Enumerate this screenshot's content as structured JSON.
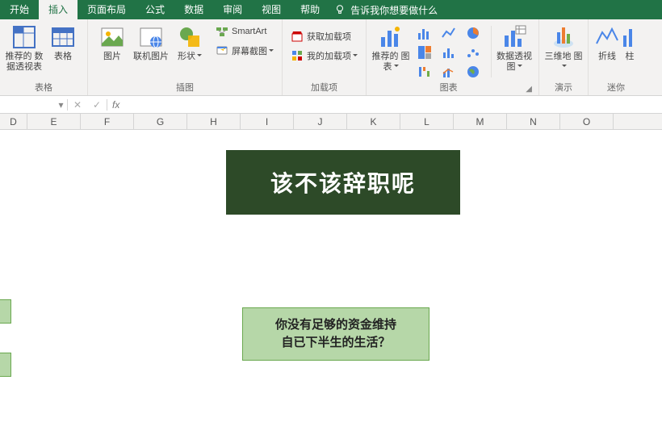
{
  "tabs": {
    "start": "开始",
    "insert": "插入",
    "layout": "页面布局",
    "formula": "公式",
    "data": "数据",
    "review": "审阅",
    "view": "视图",
    "help": "帮助",
    "tellme": "告诉我你想要做什么"
  },
  "ribbon": {
    "tables": {
      "pivottable": "推荐的\n数据透视表",
      "table": "表格",
      "label": "表格"
    },
    "illus": {
      "picture": "图片",
      "online": "联机图片",
      "shapes": "形状",
      "smartart": "SmartArt",
      "screenshot": "屏幕截图",
      "label": "插图"
    },
    "addins": {
      "get": "获取加载项",
      "my": "我的加载项",
      "label": "加载项"
    },
    "charts": {
      "recommended": "推荐的\n图表",
      "pivotchart": "数据透视图",
      "label": "图表"
    },
    "tours": {
      "map3d": "三维地\n图",
      "label": "演示"
    },
    "spark": {
      "line": "折线",
      "col": "柱",
      "label": "迷你"
    }
  },
  "columns": [
    "D",
    "E",
    "F",
    "G",
    "H",
    "I",
    "J",
    "K",
    "L",
    "M",
    "N",
    "O"
  ],
  "content": {
    "title": "该不该辞职呢",
    "question_l1": "你没有足够的资金维持",
    "question_l2": "自已下半生的生活？"
  },
  "fx": "fx"
}
